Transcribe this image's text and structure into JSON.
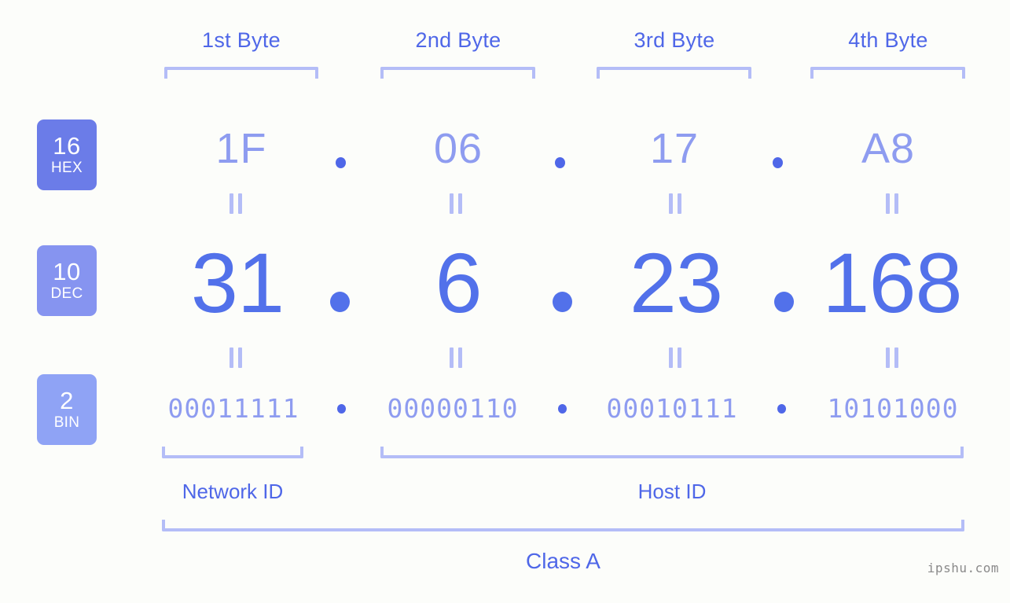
{
  "meta": {
    "background_color": "#fcfdfa",
    "accent_color": "#4f67e8",
    "muted_accent_color": "#8e9cf0",
    "bracket_color": "#b4bdf7"
  },
  "byte_headers": [
    {
      "label": "1st Byte"
    },
    {
      "label": "2nd Byte"
    },
    {
      "label": "3rd Byte"
    },
    {
      "label": "4th Byte"
    }
  ],
  "radix_badges": [
    {
      "base": "16",
      "name": "HEX",
      "color": "#6b7ce8"
    },
    {
      "base": "10",
      "name": "DEC",
      "color": "#8694f0"
    },
    {
      "base": "2",
      "name": "BIN",
      "color": "#8fa3f5"
    }
  ],
  "rows": {
    "hex": {
      "octets": [
        "1F",
        "06",
        "17",
        "A8"
      ],
      "separator": "."
    },
    "dec": {
      "octets": [
        "31",
        "6",
        "23",
        "168"
      ],
      "separator": "."
    },
    "bin": {
      "octets": [
        "00011111",
        "00000110",
        "00010111",
        "10101000"
      ],
      "separator": "."
    }
  },
  "equality_symbol": "=",
  "segments": {
    "network_id": "Network ID",
    "host_id": "Host ID",
    "class": "Class A"
  },
  "watermark": "ipshu.com"
}
